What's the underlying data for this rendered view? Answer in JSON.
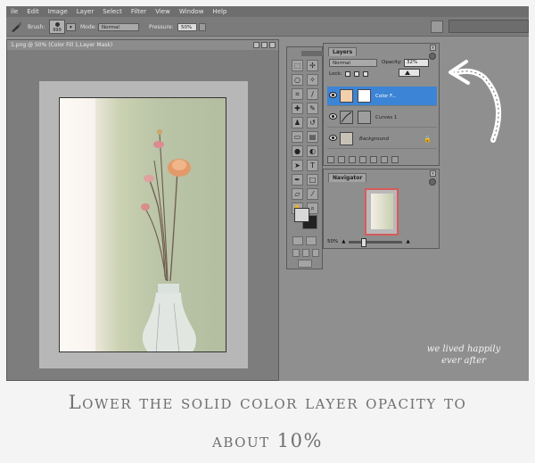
{
  "menu": [
    "ile",
    "Edit",
    "Image",
    "Layer",
    "Select",
    "Filter",
    "View",
    "Window",
    "Help"
  ],
  "options_bar": {
    "brush_label": "Brush:",
    "brush_size": "999",
    "mode_label": "Mode:",
    "mode_value": "Normal",
    "pressure_label": "Pressure:",
    "pressure_value": "50%"
  },
  "document": {
    "title": "1.png @ 50% (Color Fill 1,Layer Mask)"
  },
  "layers_panel": {
    "tab": "Layers",
    "blend_mode": "Normal",
    "opacity_label": "Opacity:",
    "opacity_value": "32%",
    "lock_label": "Lock:",
    "layers": [
      {
        "name": "Color F...",
        "selected": true,
        "thumb_color": "#f2cfad"
      },
      {
        "name": "Curves 1",
        "selected": false,
        "thumb_color": "#9a9a9a"
      },
      {
        "name": "Background",
        "selected": false,
        "thumb_color": "#c8c2b6"
      }
    ],
    "colors": {
      "selection": "#3c84d6",
      "fill_swatch": "#f2cfad"
    }
  },
  "navigator": {
    "tab": "Navigator",
    "zoom": "50%"
  },
  "watermark": {
    "line1": "we lived happily",
    "line2": "ever after"
  },
  "caption": {
    "line1": "Lower the solid color layer opacity to",
    "line2": "about 10%"
  }
}
